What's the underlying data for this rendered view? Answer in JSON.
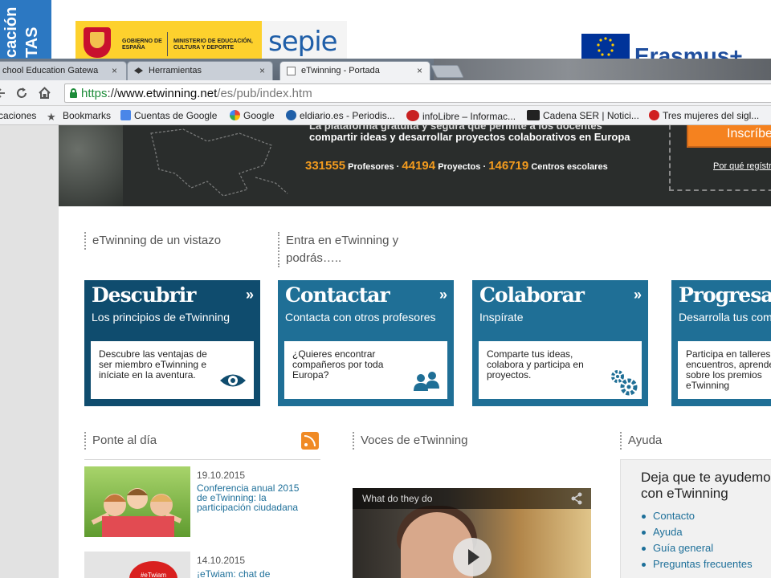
{
  "slide": {
    "left_text_1": "cación",
    "left_text_2": "TAS",
    "gov_line_1": "GOBIERNO DE ESPAÑA",
    "gov_line_2": "MINISTERIO DE EDUCACIÓN, CULTURA Y DEPORTE",
    "sepie_logo": "sepie",
    "erasmus_logo": "Erasmus+"
  },
  "browser": {
    "tabs": [
      {
        "label": "chool Education Gatewa",
        "active": false
      },
      {
        "label": "Herramientas",
        "active": false
      },
      {
        "label": "eTwinning - Portada",
        "active": true
      }
    ],
    "close_glyph": "×",
    "url_scheme": "https",
    "url_sep": "://",
    "url_host": "www.etwinning.net",
    "url_path": "/es/pub/index.htm",
    "bookmarks": [
      {
        "label": "caciones",
        "icon": "none"
      },
      {
        "label": "Bookmarks",
        "icon": "star-icon"
      },
      {
        "label": "Cuentas de Google",
        "icon": "google-g-icon"
      },
      {
        "label": "Google",
        "icon": "google-g-icon"
      },
      {
        "label": "eldiario.es - Periodis...",
        "icon": "eldiario-icon"
      },
      {
        "label": "infoLibre – Informac...",
        "icon": "infolibre-icon"
      },
      {
        "label": "Cadena SER | Notici...",
        "icon": "ser-icon"
      },
      {
        "label": "Tres mujeres del sigl...",
        "icon": "z-icon"
      }
    ]
  },
  "hero": {
    "headline_top": "La plataforma gratuita y segura que permite a los docentes",
    "headline_rest": "compartir ideas y desarrollar proyectos colaborativos en Europa",
    "stat_teachers_num": "331555",
    "stat_teachers_label": "Profesores",
    "stat_projects_num": "44194",
    "stat_projects_label": "Proyectos",
    "stat_schools_num": "146719",
    "stat_schools_label": "Centros escolares",
    "stat_sep": "·",
    "register_button": "Inscríbete",
    "why_register_link": "Por qué regístrarse"
  },
  "sections": {
    "glance": "eTwinning de un vistazo",
    "join": "Entra en eTwinning y podrás…..",
    "news": "Ponte al día",
    "voices": "Voces de eTwinning",
    "help": "Ayuda"
  },
  "cards": [
    {
      "title": "Descubrir",
      "arrow": "»",
      "subtitle": "Los principios de eTwinning",
      "text": "Descubre las ventajas de ser miembro eTwinning e iníciate en la aventura.",
      "icon": "eye-icon"
    },
    {
      "title": "Contactar",
      "arrow": "»",
      "subtitle": "Contacta con otros profesores",
      "text": "¿Quieres encontrar compañeros por toda Europa?",
      "icon": "people-icon"
    },
    {
      "title": "Colaborar",
      "arrow": "»",
      "subtitle": "Inspírate",
      "text": "Comparte tus ideas, colabora y participa en proyectos.",
      "icon": "gears-icon"
    },
    {
      "title": "Progresar",
      "arrow": "»",
      "subtitle": "Desarrolla tus competencias",
      "text": "Participa en talleres, encuentros, aprende sobre los premios eTwinning",
      "icon": "none"
    }
  ],
  "news": [
    {
      "date": "19.10.2015",
      "title": "Conferencia anual 2015 de eTwinning: la participación ciudadana"
    },
    {
      "date": "14.10.2015",
      "title": "¡eTwiam: chat de",
      "badge": "#eTwiam"
    }
  ],
  "video": {
    "title": "What do they do"
  },
  "help": {
    "title": "Deja que te ayudemos con eTwinning",
    "links": [
      "Contacto",
      "Ayuda",
      "Guía general",
      "Preguntas frecuentes"
    ]
  }
}
